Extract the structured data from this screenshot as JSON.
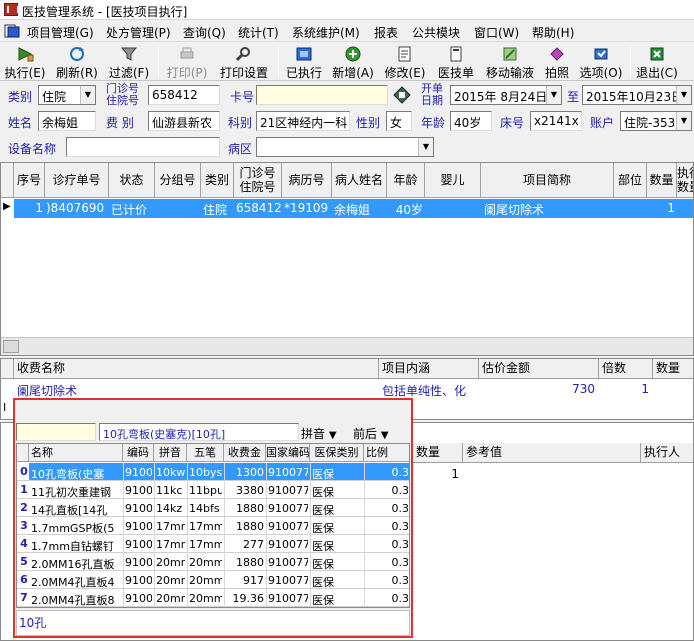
{
  "window": {
    "title": "医技管理系统 - [医技项目执行]"
  },
  "menu": [
    "项目管理(G)",
    "处方管理(P)",
    "查询(Q)",
    "统计(T)",
    "系统维护(M)",
    "报表",
    "公共模块",
    "窗口(W)",
    "帮助(H)"
  ],
  "toolbar": [
    {
      "label": "执行(E)",
      "icon": "execute-icon",
      "enabled": true
    },
    {
      "label": "刷新(R)",
      "icon": "refresh-icon",
      "enabled": true
    },
    {
      "label": "过滤(F)",
      "icon": "filter-icon",
      "enabled": true
    },
    {
      "label": "打印(P)",
      "icon": "print-icon",
      "enabled": false
    },
    {
      "label": "打印设置",
      "icon": "print-settings-icon",
      "enabled": true
    },
    {
      "label": "已执行",
      "icon": "executed-icon",
      "enabled": true
    },
    {
      "label": "新增(A)",
      "icon": "add-icon",
      "enabled": true
    },
    {
      "label": "修改(E)",
      "icon": "edit-icon",
      "enabled": true
    },
    {
      "label": "医技单",
      "icon": "document-icon",
      "enabled": true
    },
    {
      "label": "移动输液",
      "icon": "mobile-infusion-icon",
      "enabled": true
    },
    {
      "label": "拍照",
      "icon": "camera-icon",
      "enabled": true
    },
    {
      "label": "选项(O)",
      "icon": "options-icon",
      "enabled": true
    },
    {
      "label": "退出(C)",
      "icon": "exit-icon",
      "enabled": true
    }
  ],
  "form": {
    "category_label": "类别",
    "category_value": "住院",
    "outpatient_label_line1": "门诊号",
    "outpatient_label_line2": "住院号",
    "outpatient_value": "658412",
    "card_label": "卡号",
    "card_value": "",
    "start_label_line1": "开单",
    "start_label_line2": "日期",
    "start_date": "2015年 8月24日",
    "to_label": "至",
    "end_date": "2015年10月23日",
    "name_label": "姓名",
    "name_value": "余梅姐",
    "fee_label": "费  别",
    "fee_value": "仙游县新农",
    "dept_label": "科别",
    "dept_value": "21区神经内一科",
    "sex_label": "性别",
    "sex_value": "女",
    "age_label": "年龄",
    "age_value": "40岁",
    "bed_label": "床号",
    "bed_value": "x2141x",
    "account_label": "账户",
    "account_value": "住院-353",
    "device_label": "设备名称",
    "device_value": "",
    "ward_label": "病区",
    "ward_value": ""
  },
  "main_grid": {
    "columns": [
      "序号",
      "诊疗单号",
      "状态",
      "分组号",
      "类别",
      "门诊号住院号",
      "病历号",
      "病人姓名",
      "年龄",
      "婴儿",
      "项目简称",
      "部位",
      "数量",
      "执行数量"
    ],
    "col_label_mz": "门诊号",
    "col_label_zy": "住院号",
    "col_label_zx": "执行",
    "col_label_sl": "数量",
    "rows": [
      {
        "seq": "1",
        "order_no": ")8407690",
        "status": "已计价",
        "group": "",
        "category": "住院",
        "patient_no": "658412",
        "record_no": "*19109",
        "patient_name": "余梅姐",
        "age": "40岁",
        "infant": "",
        "item": "阑尾切除术",
        "site": "",
        "qty": "1"
      }
    ]
  },
  "charge_grid": {
    "columns": [
      "收费名称",
      "项目内涵",
      "估价金额",
      "倍数",
      "数量"
    ],
    "rows": [
      {
        "name": "阑尾切除术",
        "content": "包括单纯性、化",
        "amount": "730",
        "multiple": "1",
        "qty": ""
      }
    ]
  },
  "lower_grid": {
    "columns": [
      "数量",
      "参考值",
      "执行人"
    ],
    "rows": [
      {
        "qty": "1",
        "ref": "",
        "executor": ""
      }
    ]
  },
  "popup": {
    "search_value": "",
    "selected_display": "10孔弯板(史塞克)[10孔]",
    "pinyin_label": "拼音",
    "match_label": "前后",
    "columns": [
      "名称",
      "编码",
      "拼音",
      "五笔",
      "收费金",
      "国家编码",
      "医保类别",
      "比例"
    ],
    "rows": [
      {
        "name": "10孔弯板(史塞",
        "code": "9100",
        "pinyin": "10kw",
        "wubi": "10bys",
        "fee": "1300",
        "national": "910077",
        "ins": "医保",
        "ratio": "0.3"
      },
      {
        "name": "11孔初次重建钢",
        "code": "9100",
        "pinyin": "11kc",
        "wubi": "11bpu",
        "fee": "3380",
        "national": "910077",
        "ins": "医保",
        "ratio": "0.3"
      },
      {
        "name": "14孔直板[14孔",
        "code": "9100",
        "pinyin": "14kz",
        "wubi": "14bfs",
        "fee": "1880",
        "national": "910077",
        "ins": "医保",
        "ratio": "0.3"
      },
      {
        "name": "1.7mmGSP板(5",
        "code": "9100",
        "pinyin": "17mm",
        "wubi": "17mmg",
        "fee": "1880",
        "national": "910077",
        "ins": "医保",
        "ratio": "0.3"
      },
      {
        "name": "1.7mm自钻螺钉",
        "code": "9100",
        "pinyin": "17mm",
        "wubi": "17mmt",
        "fee": "277",
        "national": "910077",
        "ins": "医保",
        "ratio": "0.3"
      },
      {
        "name": "2.0MM16孔直板",
        "code": "9100",
        "pinyin": "20mm",
        "wubi": "20mm1",
        "fee": "1880",
        "national": "910077",
        "ins": "医保",
        "ratio": "0.3"
      },
      {
        "name": "2.0MM4孔直板4",
        "code": "9100",
        "pinyin": "20mm",
        "wubi": "20mm4",
        "fee": "917",
        "national": "910077",
        "ins": "医保",
        "ratio": "0.3"
      },
      {
        "name": "2.0MM4孔直板8",
        "code": "9100",
        "pinyin": "20mm",
        "wubi": "20mm4",
        "fee": "19.36",
        "national": "910077",
        "ins": "医保",
        "ratio": "0.3"
      }
    ],
    "footer": "10孔"
  },
  "colors": {
    "selection": "#3399ff",
    "label_blue": "#2020b0",
    "highlight_border": "#e03030",
    "input_yellow": "#ffffe0"
  }
}
